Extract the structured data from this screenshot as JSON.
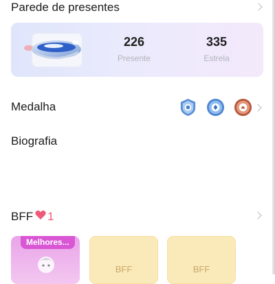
{
  "gift_wall": {
    "title": "Parede de presentes",
    "gifts_count": "226",
    "gifts_label": "Presente",
    "stars_count": "335",
    "stars_label": "Estrela"
  },
  "medals": {
    "title": "Medalha",
    "items": [
      {
        "icon": "blue-shield-medal-icon"
      },
      {
        "icon": "blue-round-medal-icon"
      },
      {
        "icon": "bronze-medal-icon"
      }
    ]
  },
  "biography": {
    "title": "Biografia"
  },
  "bff": {
    "title": "BFF",
    "count": "1",
    "heart_color": "#ef5a7a",
    "cards": [
      {
        "tag": "Melhores..."
      },
      {
        "label": "BFF"
      },
      {
        "label": "BFF"
      }
    ]
  }
}
